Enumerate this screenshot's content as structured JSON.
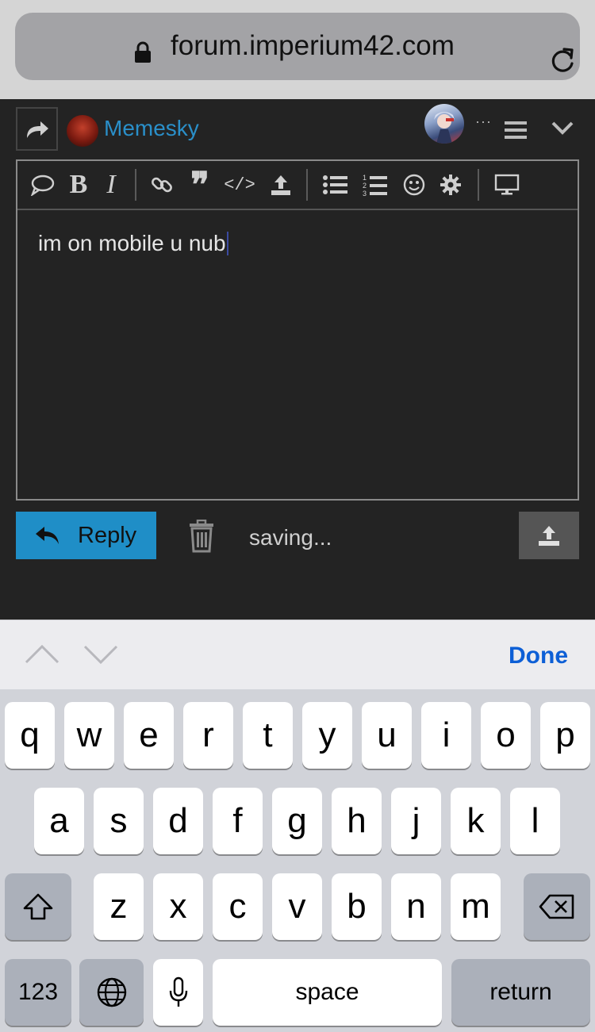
{
  "browser": {
    "url": "forum.imperium42.com"
  },
  "post": {
    "username": "Memesky",
    "more": "···",
    "editor_text": "im on mobile u nub",
    "reply_label": "Reply",
    "status": "saving..."
  },
  "accessory": {
    "done_label": "Done"
  },
  "keyboard": {
    "row1": [
      "q",
      "w",
      "e",
      "r",
      "t",
      "y",
      "u",
      "i",
      "o",
      "p"
    ],
    "row2": [
      "a",
      "s",
      "d",
      "f",
      "g",
      "h",
      "j",
      "k",
      "l"
    ],
    "row3": [
      "z",
      "x",
      "c",
      "v",
      "b",
      "n",
      "m"
    ],
    "numbers_label": "123",
    "space_label": "space",
    "return_label": "return"
  },
  "colors": {
    "accent": "#1f8ec7",
    "username": "#2a8fc9",
    "done": "#0d5fd6"
  }
}
